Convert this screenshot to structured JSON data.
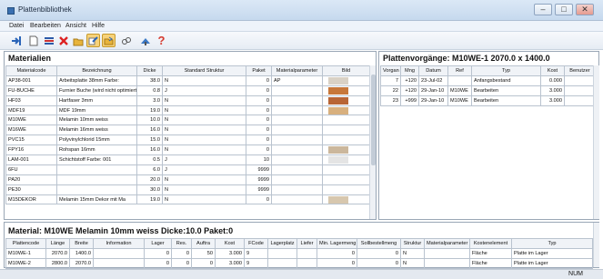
{
  "window": {
    "title": "Plattenbibliothek",
    "minimize": "–",
    "maximize": "□",
    "close": "✕"
  },
  "menu": [
    "Datei",
    "Bearbeiten",
    "Ansicht",
    "Hilfe"
  ],
  "toolbar": {
    "icons": [
      "import-icon",
      "new-icon",
      "list-icon",
      "delete-icon",
      "open-icon",
      "edit-icon",
      "export-icon",
      "link-icon",
      "settings-icon",
      "help-icon"
    ],
    "help_glyph": "?"
  },
  "materials": {
    "title": "Materialien",
    "columns": [
      "Materialcode",
      "Bezeichnung",
      "Dicke",
      "Standard Struktur",
      "Paket",
      "Materialparameter",
      "Bild"
    ],
    "rows": [
      {
        "code": "AP38-001",
        "name": "Arbeitsplatte 38mm Farbe:",
        "dicke": "38.0",
        "struktur": "N",
        "paket": "0",
        "param": "AP",
        "color": "#d9d1c5"
      },
      {
        "code": "FU-BUCHE",
        "name": "Furnier Buche (wird nicht optimiert)",
        "dicke": "0.8",
        "struktur": "J",
        "paket": "0",
        "param": "",
        "color": "#c7773a"
      },
      {
        "code": "HF03",
        "name": "Hartfaser 3mm",
        "dicke": "3.0",
        "struktur": "N",
        "paket": "0",
        "param": "",
        "color": "#b86536"
      },
      {
        "code": "MDF19",
        "name": "MDF 19mm",
        "dicke": "19.0",
        "struktur": "N",
        "paket": "0",
        "param": "",
        "color": "#d8b07e"
      },
      {
        "code": "M10WE",
        "name": "Melamin 10mm weiss",
        "dicke": "10.0",
        "struktur": "N",
        "paket": "0",
        "param": "",
        "color": ""
      },
      {
        "code": "M16WE",
        "name": "Melamin 16mm weiss",
        "dicke": "16.0",
        "struktur": "N",
        "paket": "0",
        "param": "",
        "color": ""
      },
      {
        "code": "PVC15",
        "name": "Polyvinylchlorid 15mm",
        "dicke": "15.0",
        "struktur": "N",
        "paket": "0",
        "param": "",
        "color": ""
      },
      {
        "code": "FPY16",
        "name": "Rohspan 16mm",
        "dicke": "16.0",
        "struktur": "N",
        "paket": "0",
        "param": "",
        "color": "#cbb79c"
      },
      {
        "code": "LAM-001",
        "name": "Schichtstoff Farbe: 001",
        "dicke": "0.5",
        "struktur": "J",
        "paket": "10",
        "param": "",
        "color": "#e4e4e4"
      },
      {
        "code": "6FU",
        "name": "",
        "dicke": "6.0",
        "struktur": "J",
        "paket": "9999",
        "param": "",
        "color": ""
      },
      {
        "code": "PA20",
        "name": "",
        "dicke": "20.0",
        "struktur": "N",
        "paket": "9999",
        "param": "",
        "color": ""
      },
      {
        "code": "PE30",
        "name": "",
        "dicke": "30.0",
        "struktur": "N",
        "paket": "9999",
        "param": "",
        "color": ""
      },
      {
        "code": "M15DEKOR",
        "name": "Melamin 15mm Dekor mit Ma",
        "dicke": "19.0",
        "struktur": "N",
        "paket": "0",
        "param": "",
        "color": "#d7c7ae"
      }
    ]
  },
  "vorgaenge": {
    "title": "Plattenvorgänge: M10WE-1  2070.0 x 1400.0",
    "columns": [
      "Vorgan",
      "Mng",
      "Datum",
      "Ref",
      "Typ",
      "Kost",
      "Benutzer"
    ],
    "rows": [
      {
        "nr": "7",
        "mng": "+120",
        "datum": "23-Jul-02",
        "ref": "",
        "typ": "Anfangsbestand",
        "kost": "0.000",
        "user": ""
      },
      {
        "nr": "22",
        "mng": "+120",
        "datum": "29-Jan-10",
        "ref": "M10WE",
        "typ": "Bearbeiten",
        "kost": "3.000",
        "user": ""
      },
      {
        "nr": "23",
        "mng": "+999",
        "datum": "29-Jan-10",
        "ref": "M10WE",
        "typ": "Bearbeiten",
        "kost": "3.000",
        "user": ""
      }
    ]
  },
  "material_detail": {
    "title": "Material: M10WE Melamin 10mm weiss Dicke:10.0 Paket:0",
    "columns": [
      "Plattencode",
      "Länge",
      "Breite",
      "Information",
      "Lager",
      "Res.",
      "Auftra",
      "Kost",
      "FCode",
      "Lagerplatz",
      "Liefer",
      "Min. Lagermeng",
      "Sollbestellmeng",
      "Struktur",
      "Materialparameter",
      "Kostenelement",
      "Typ"
    ],
    "rows": [
      {
        "code": "M10WE-1",
        "laenge": "2070.0",
        "breite": "1400.0",
        "info": "",
        "lager": "0",
        "res": "0",
        "auftrag": "50",
        "kost": "3.000",
        "fcode": "9",
        "platz": "",
        "liefer": "",
        "min": "0",
        "soll": "0",
        "struktur": "N",
        "param": "",
        "kostel": "Fläche",
        "typ": "Platte im Lager"
      },
      {
        "code": "M10WE-2",
        "laenge": "2800.0",
        "breite": "2070.0",
        "info": "",
        "lager": "0",
        "res": "0",
        "auftrag": "0",
        "kost": "3.000",
        "fcode": "9",
        "platz": "",
        "liefer": "",
        "min": "0",
        "soll": "0",
        "struktur": "N",
        "param": "",
        "kostel": "Fläche",
        "typ": "Platte im Lager"
      }
    ]
  },
  "status": {
    "num": "NUM"
  }
}
